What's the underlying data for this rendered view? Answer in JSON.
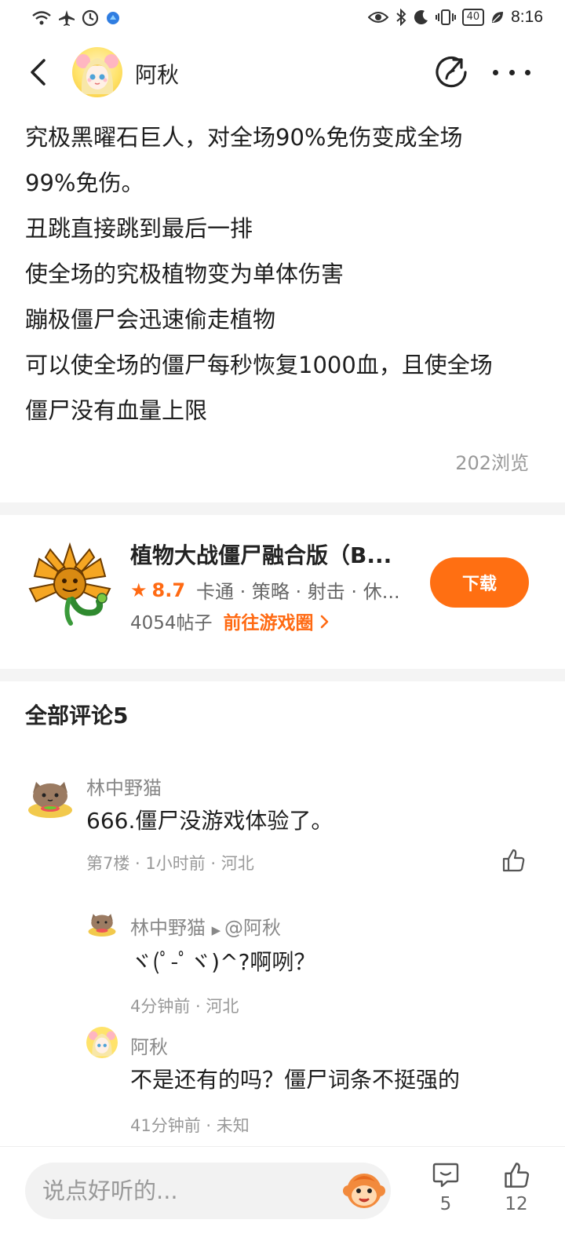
{
  "status_bar": {
    "time": "8:16",
    "battery": "40",
    "left_icons": [
      "wifi-icon",
      "airplane-icon",
      "timer-icon",
      "app-notification-icon"
    ],
    "right_icons": [
      "eye-icon",
      "bluetooth-icon",
      "moon-icon",
      "vibrate-icon",
      "battery-icon",
      "leaf-icon"
    ]
  },
  "header": {
    "author_name": "阿秋"
  },
  "post": {
    "lines": [
      "究极黑曜石巨人，对全场90%免伤变成全场",
      "99%免伤。",
      "丑跳直接跳到最后一排",
      "使全场的究极植物变为单体伤害",
      "蹦极僵尸会迅速偷走植物",
      "可以使全场的僵尸每秒恢复1000血，且使全场",
      "僵尸没有血量上限"
    ],
    "views": "202浏览"
  },
  "game_card": {
    "title": "植物大战僵尸融合版（B...",
    "rating": "8.7",
    "tags": "卡通 · 策略 · 射击 · 休...",
    "post_count": "4054帖子",
    "goto_circle": "前往游戏圈",
    "download_label": "下载"
  },
  "comments": {
    "header": "全部评论5",
    "items": [
      {
        "user": "林中野猫",
        "text": "666.僵尸没游戏体验了。",
        "meta": "第7楼 · 1小时前 · 河北"
      },
      {
        "user": "林中野猫",
        "reply_to": "@阿秋",
        "text": "ヾ(ﾟ-ﾟヾ)^?啊咧？",
        "meta": "4分钟前 · 河北"
      },
      {
        "user": "阿秋",
        "text": "不是还有的吗？僵尸词条不挺强的",
        "meta": "41分钟前 · 未知"
      }
    ]
  },
  "bottom_bar": {
    "input_placeholder": "说点好听的...",
    "comment_count": "5",
    "like_count": "12"
  },
  "colors": {
    "accent": "#ff6f12",
    "text_primary": "#1e1e1e",
    "text_secondary": "#999999",
    "divider": "#f4f4f4"
  }
}
